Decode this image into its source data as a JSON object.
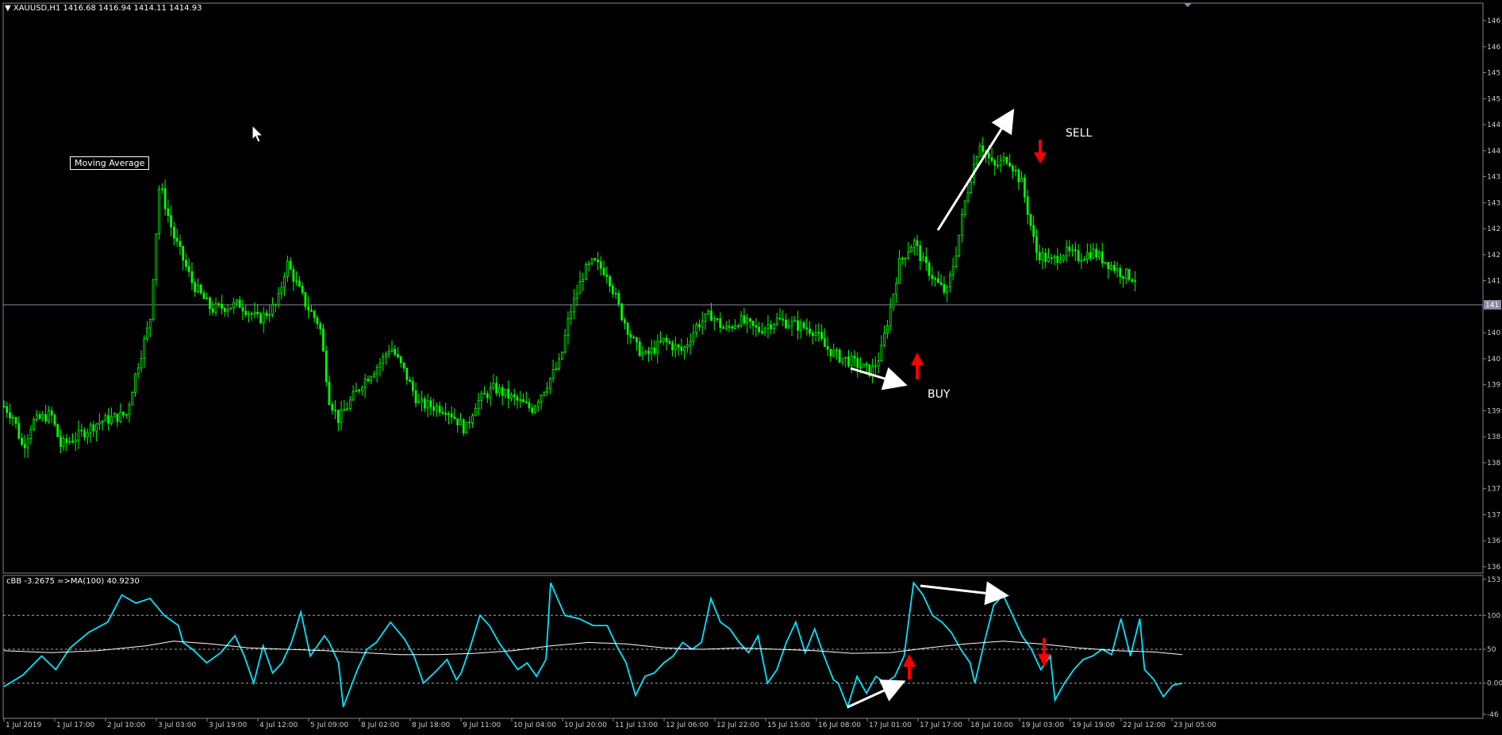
{
  "header": {
    "symbol_line": "▼ XAUUSD,H1  1416.68 1416.94 1414.11 1414.93"
  },
  "labels": {
    "moving_average": "Moving Average",
    "buy": "BUY",
    "sell": "SELL"
  },
  "subwindow": {
    "header": "cBB -3.2675  =>MA(100) 40.9230"
  },
  "colors": {
    "background": "#000000",
    "candles": "#00ff00",
    "oscillator": "#00e5ff",
    "signal_line": "#ffffff",
    "arrows": "#ff0000",
    "annotations": "#ffffff"
  },
  "chart_data": [
    {
      "type": "candlestick",
      "symbol": "XAUUSD",
      "timeframe": "H1",
      "ohlc_last": {
        "open": 1416.68,
        "high": 1416.94,
        "low": 1414.11,
        "close": 1414.93
      },
      "y_tick_labels": [
        "146",
        "146",
        "145",
        "145",
        "144",
        "144",
        "143",
        "143",
        "142",
        "142",
        "141",
        "141",
        "140",
        "140",
        "139",
        "139",
        "138",
        "138",
        "137",
        "137",
        "136",
        "136"
      ],
      "current_price_label": "141",
      "close_path": [
        [
          0,
          1390.5
        ],
        [
          0.01,
          1388.5
        ],
        [
          0.02,
          1382.5
        ],
        [
          0.03,
          1387.5
        ],
        [
          0.05,
          1389.0
        ],
        [
          0.06,
          1383.0
        ],
        [
          0.08,
          1385.0
        ],
        [
          0.1,
          1387.5
        ],
        [
          0.13,
          1389.0
        ],
        [
          0.14,
          1397.0
        ],
        [
          0.155,
          1407.0
        ],
        [
          0.165,
          1433.0
        ],
        [
          0.18,
          1423.0
        ],
        [
          0.2,
          1414.0
        ],
        [
          0.22,
          1409.0
        ],
        [
          0.25,
          1410.0
        ],
        [
          0.27,
          1407.0
        ],
        [
          0.29,
          1410.0
        ],
        [
          0.3,
          1418.0
        ],
        [
          0.32,
          1410.0
        ],
        [
          0.335,
          1406.0
        ],
        [
          0.345,
          1392.0
        ],
        [
          0.355,
          1388.0
        ],
        [
          0.38,
          1395.0
        ],
        [
          0.4,
          1399.0
        ],
        [
          0.41,
          1402.0
        ],
        [
          0.425,
          1397.0
        ],
        [
          0.44,
          1391.0
        ],
        [
          0.47,
          1390.0
        ],
        [
          0.49,
          1386.0
        ],
        [
          0.5,
          1391.0
        ],
        [
          0.52,
          1394.0
        ],
        [
          0.54,
          1392.0
        ],
        [
          0.56,
          1390.0
        ],
        [
          0.57,
          1393.0
        ],
        [
          0.59,
          1399.0
        ],
        [
          0.6,
          1408.0
        ],
        [
          0.615,
          1416.0
        ],
        [
          0.625,
          1418.0
        ],
        [
          0.64,
          1416.0
        ],
        [
          0.655,
          1408.0
        ],
        [
          0.67,
          1402.0
        ],
        [
          0.68,
          1400.0
        ],
        [
          0.7,
          1403.0
        ],
        [
          0.72,
          1401.0
        ],
        [
          0.735,
          1406.0
        ],
        [
          0.75,
          1408.0
        ],
        [
          0.765,
          1405.0
        ],
        [
          0.78,
          1407.0
        ],
        [
          0.8,
          1405.0
        ],
        [
          0.82,
          1407.0
        ],
        [
          0.84,
          1406.0
        ],
        [
          0.86,
          1405.0
        ],
        [
          0.87,
          1402.0
        ],
        [
          0.885,
          1400.0
        ],
        [
          0.9,
          1399.0
        ],
        [
          0.91,
          1398.0
        ],
        [
          0.92,
          1397.0
        ],
        [
          0.93,
          1400.5
        ],
        [
          0.94,
          1409.0
        ],
        [
          0.95,
          1418.0
        ],
        [
          0.965,
          1422.0
        ],
        [
          0.975,
          1418.0
        ],
        [
          0.99,
          1414.0
        ],
        [
          1.0,
          1412.0
        ],
        [
          1.01,
          1420.0
        ],
        [
          1.02,
          1430.0
        ],
        [
          1.035,
          1441.0
        ],
        [
          1.05,
          1436.0
        ],
        [
          1.065,
          1438.0
        ],
        [
          1.08,
          1433.0
        ],
        [
          1.095,
          1420.0
        ],
        [
          1.11,
          1418.0
        ],
        [
          1.125,
          1420.0
        ],
        [
          1.14,
          1419.0
        ],
        [
          1.155,
          1420.0
        ],
        [
          1.17,
          1418.0
        ],
        [
          1.185,
          1416.0
        ],
        [
          1.2,
          1414.93
        ]
      ]
    },
    {
      "type": "line",
      "title": "cBB -3.2675  =>MA(100) 40.9230",
      "y_tick_labels": [
        "153",
        "100",
        "50",
        "0.00",
        "-46"
      ],
      "reference_levels": [
        100,
        50,
        0
      ],
      "series": [
        {
          "values": [
            [
              0,
              -5
            ],
            [
              0.02,
              12
            ],
            [
              0.04,
              40
            ],
            [
              0.055,
              20
            ],
            [
              0.07,
              52
            ],
            [
              0.09,
              75
            ],
            [
              0.11,
              90
            ],
            [
              0.125,
              130
            ],
            [
              0.14,
              118
            ],
            [
              0.155,
              125
            ],
            [
              0.17,
              100
            ],
            [
              0.185,
              85
            ],
            [
              0.19,
              60
            ],
            [
              0.2,
              50
            ],
            [
              0.215,
              30
            ],
            [
              0.23,
              45
            ],
            [
              0.245,
              70
            ],
            [
              0.255,
              40
            ],
            [
              0.265,
              0
            ],
            [
              0.275,
              55
            ],
            [
              0.285,
              15
            ],
            [
              0.295,
              30
            ],
            [
              0.305,
              60
            ],
            [
              0.315,
              105
            ],
            [
              0.325,
              40
            ],
            [
              0.34,
              70
            ],
            [
              0.345,
              60
            ],
            [
              0.355,
              30
            ],
            [
              0.36,
              -35
            ],
            [
              0.375,
              20
            ],
            [
              0.385,
              50
            ],
            [
              0.395,
              60
            ],
            [
              0.41,
              90
            ],
            [
              0.425,
              65
            ],
            [
              0.435,
              40
            ],
            [
              0.445,
              0
            ],
            [
              0.46,
              20
            ],
            [
              0.47,
              35
            ],
            [
              0.48,
              5
            ],
            [
              0.485,
              15
            ],
            [
              0.495,
              55
            ],
            [
              0.505,
              100
            ],
            [
              0.515,
              85
            ],
            [
              0.525,
              60
            ],
            [
              0.535,
              40
            ],
            [
              0.545,
              20
            ],
            [
              0.555,
              30
            ],
            [
              0.565,
              10
            ],
            [
              0.575,
              35
            ],
            [
              0.58,
              148
            ],
            [
              0.595,
              100
            ],
            [
              0.61,
              95
            ],
            [
              0.625,
              85
            ],
            [
              0.64,
              85
            ],
            [
              0.65,
              55
            ],
            [
              0.66,
              30
            ],
            [
              0.67,
              -18
            ],
            [
              0.68,
              10
            ],
            [
              0.69,
              15
            ],
            [
              0.7,
              30
            ],
            [
              0.71,
              40
            ],
            [
              0.72,
              60
            ],
            [
              0.73,
              50
            ],
            [
              0.74,
              60
            ],
            [
              0.75,
              125
            ],
            [
              0.76,
              90
            ],
            [
              0.77,
              80
            ],
            [
              0.78,
              60
            ],
            [
              0.79,
              45
            ],
            [
              0.8,
              70
            ],
            [
              0.81,
              0
            ],
            [
              0.82,
              20
            ],
            [
              0.83,
              60
            ],
            [
              0.84,
              90
            ],
            [
              0.85,
              45
            ],
            [
              0.86,
              80
            ],
            [
              0.87,
              40
            ],
            [
              0.88,
              5
            ],
            [
              0.885,
              0
            ],
            [
              0.895,
              -35
            ],
            [
              0.905,
              10
            ],
            [
              0.915,
              -15
            ],
            [
              0.925,
              10
            ],
            [
              0.935,
              0
            ],
            [
              0.945,
              10
            ],
            [
              0.955,
              40
            ],
            [
              0.965,
              148
            ],
            [
              0.975,
              130
            ],
            [
              0.985,
              100
            ],
            [
              0.995,
              90
            ],
            [
              1.005,
              75
            ],
            [
              1.015,
              50
            ],
            [
              1.025,
              30
            ],
            [
              1.03,
              0
            ],
            [
              1.04,
              60
            ],
            [
              1.05,
              115
            ],
            [
              1.06,
              130
            ],
            [
              1.07,
              100
            ],
            [
              1.08,
              70
            ],
            [
              1.09,
              50
            ],
            [
              1.1,
              20
            ],
            [
              1.11,
              40
            ],
            [
              1.115,
              -25
            ],
            [
              1.125,
              0
            ],
            [
              1.135,
              20
            ],
            [
              1.145,
              35
            ],
            [
              1.155,
              40
            ],
            [
              1.165,
              50
            ],
            [
              1.175,
              42
            ],
            [
              1.185,
              95
            ],
            [
              1.195,
              40
            ],
            [
              1.205,
              95
            ],
            [
              1.21,
              20
            ],
            [
              1.22,
              5
            ],
            [
              1.23,
              -20
            ],
            [
              1.24,
              -3
            ],
            [
              1.25,
              0
            ]
          ]
        },
        {
          "values": [
            [
              0,
              48
            ],
            [
              0.05,
              45
            ],
            [
              0.1,
              48
            ],
            [
              0.15,
              55
            ],
            [
              0.18,
              62
            ],
            [
              0.22,
              58
            ],
            [
              0.26,
              52
            ],
            [
              0.3,
              50
            ],
            [
              0.34,
              48
            ],
            [
              0.38,
              45
            ],
            [
              0.42,
              42
            ],
            [
              0.46,
              42
            ],
            [
              0.5,
              44
            ],
            [
              0.54,
              48
            ],
            [
              0.58,
              55
            ],
            [
              0.62,
              60
            ],
            [
              0.66,
              58
            ],
            [
              0.7,
              52
            ],
            [
              0.74,
              50
            ],
            [
              0.78,
              52
            ],
            [
              0.82,
              50
            ],
            [
              0.86,
              48
            ],
            [
              0.9,
              44
            ],
            [
              0.94,
              45
            ],
            [
              0.98,
              52
            ],
            [
              1.02,
              58
            ],
            [
              1.06,
              62
            ],
            [
              1.1,
              58
            ],
            [
              1.14,
              52
            ],
            [
              1.18,
              48
            ],
            [
              1.22,
              46
            ],
            [
              1.25,
              42
            ]
          ]
        }
      ]
    }
  ],
  "x_axis": {
    "tick_labels": [
      "1 Jul 2019",
      "1 Jul 17:00",
      "2 Jul 10:00",
      "3 Jul 03:00",
      "3 Jul 19:00",
      "4 Jul 12:00",
      "5 Jul 09:00",
      "8 Jul 02:00",
      "8 Jul 18:00",
      "9 Jul 11:00",
      "10 Jul 04:00",
      "10 Jul 20:00",
      "11 Jul 13:00",
      "12 Jul 06:00",
      "12 Jul 22:00",
      "15 Jul 15:00",
      "16 Jul 08:00",
      "17 Jul 01:00",
      "17 Jul 17:00",
      "18 Jul 10:00",
      "19 Jul 03:00",
      "19 Jul 19:00",
      "22 Jul 12:00",
      "23 Jul 05:00"
    ]
  }
}
